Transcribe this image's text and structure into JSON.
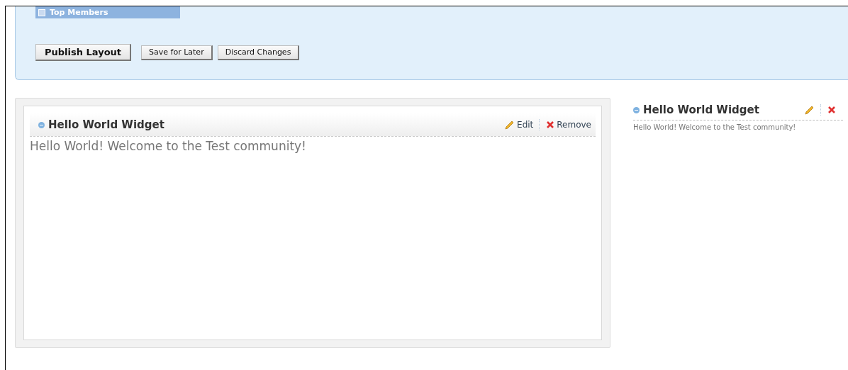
{
  "top_members": {
    "label": "Top Members"
  },
  "buttons": [
    {
      "label": "Publish Layout",
      "kind": "primary"
    },
    {
      "label": "Save for Later",
      "kind": "secondary"
    },
    {
      "label": "Discard Changes",
      "kind": "secondary"
    }
  ],
  "main_widget": {
    "title": "Hello World Widget",
    "edit": "Edit",
    "remove": "Remove",
    "body": "Hello World! Welcome to the Test community!"
  },
  "side_widget": {
    "title": "Hello World Widget",
    "body": "Hello World! Welcome to the Test community!"
  }
}
